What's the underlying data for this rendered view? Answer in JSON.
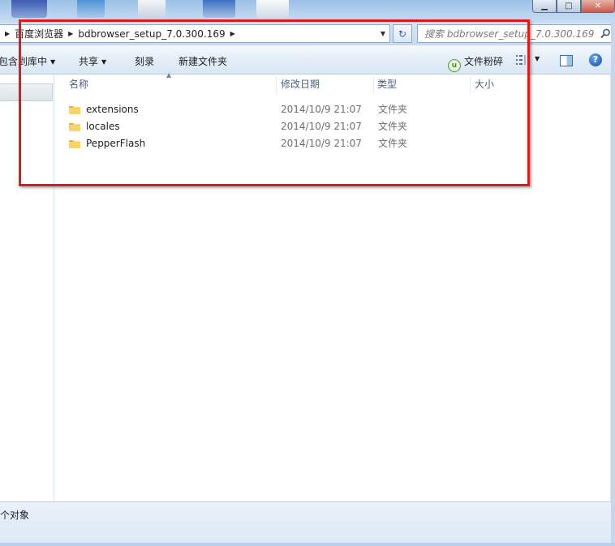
{
  "window": {
    "minimize_glyph": "▁",
    "maximize_glyph": "□",
    "close_glyph": "✕"
  },
  "address": {
    "crumbs": [
      "百度浏览器",
      "bdbrowser_setup_7.0.300.169"
    ],
    "refresh_glyph": "↻"
  },
  "search": {
    "placeholder": "搜索 bdbrowser_setup_7.0.300.169"
  },
  "toolbar": {
    "include_library": "包含到库中",
    "share": "共享",
    "burn": "刻录",
    "new_folder": "新建文件夹",
    "shredder": "文件粉碎",
    "shredder_glyph": "u",
    "help_glyph": "?"
  },
  "columns": {
    "name": "名称",
    "modified": "修改日期",
    "type": "类型",
    "size": "大小"
  },
  "files": [
    {
      "name": "extensions",
      "modified": "2014/10/9 21:07",
      "type": "文件夹"
    },
    {
      "name": "locales",
      "modified": "2014/10/9 21:07",
      "type": "文件夹"
    },
    {
      "name": "PepperFlash",
      "modified": "2014/10/9 21:07",
      "type": "文件夹"
    }
  ],
  "status": {
    "text": "个对象"
  },
  "colors": {
    "highlight": "#e01a1a",
    "folder": "#f2c54a"
  }
}
